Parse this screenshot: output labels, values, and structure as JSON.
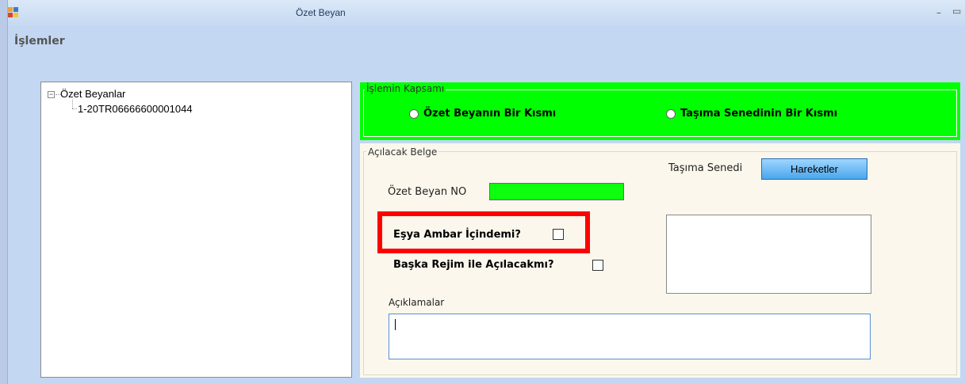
{
  "window": {
    "title": "Özet Beyan",
    "minimize_glyph": "–",
    "maximize_glyph": "▭"
  },
  "menu": {
    "label": "İşlemler"
  },
  "tree": {
    "root_label": "Özet Beyanlar",
    "toggle_glyph": "−",
    "children": [
      "1-20TR06666600001044"
    ]
  },
  "scope": {
    "legend": "İşlemin Kapsamı",
    "options": [
      "Özet Beyanın Bir Kısmı",
      "Taşıma Senedinin Bir Kısmı"
    ]
  },
  "document": {
    "legend": "Açılacak Belge",
    "tasima_senedi_label": "Taşıma Senedi",
    "hareketler_button": "Hareketler",
    "ozet_beyan_no_label": "Özet Beyan NO",
    "ozet_beyan_no_value": "",
    "esya_ambar_label": "Eşya Ambar İçindemi?",
    "baska_rejim_label": "Başka Rejim ile Açılacakmı?",
    "aciklamalar_label": "Açıklamalar",
    "aciklamalar_value": ""
  },
  "colors": {
    "scope_background": "#00ff00",
    "highlight": "#ff0000",
    "document_background": "#fbf7ec"
  }
}
